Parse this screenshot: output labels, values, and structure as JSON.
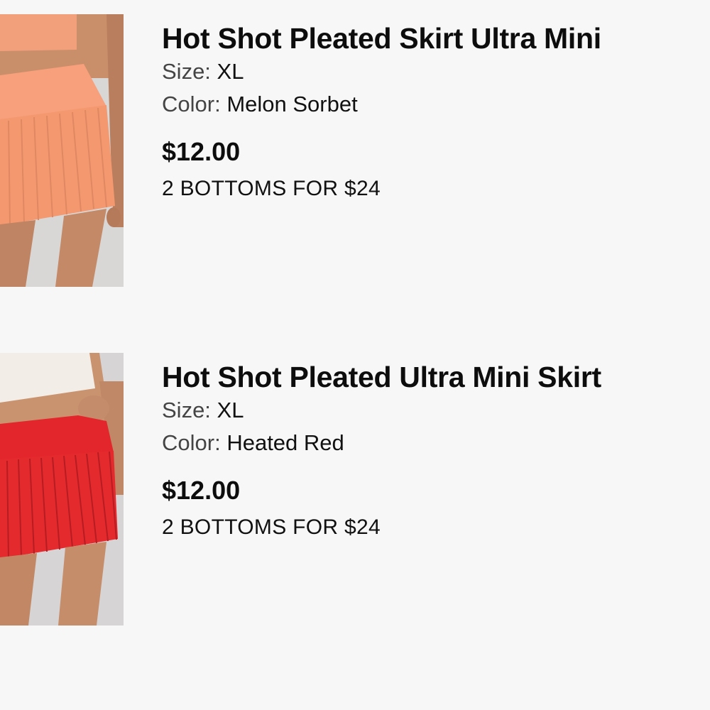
{
  "products": [
    {
      "title": "Hot Shot Pleated Skirt Ultra Mini",
      "size_label": "Size:",
      "size_value": "XL",
      "color_label": "Color:",
      "color_value": "Melon Sorbet",
      "price": "$12.00",
      "promo": "2 BOTTOMS FOR $24",
      "image_icon": "product-photo-melon-skirt",
      "swatch": "#f7a07b"
    },
    {
      "title": "Hot Shot Pleated Ultra Mini Skirt",
      "size_label": "Size:",
      "size_value": "XL",
      "color_label": "Color:",
      "color_value": "Heated Red",
      "price": "$12.00",
      "promo": "2 BOTTOMS FOR $24",
      "image_icon": "product-photo-red-skirt",
      "swatch": "#e3262b"
    }
  ]
}
